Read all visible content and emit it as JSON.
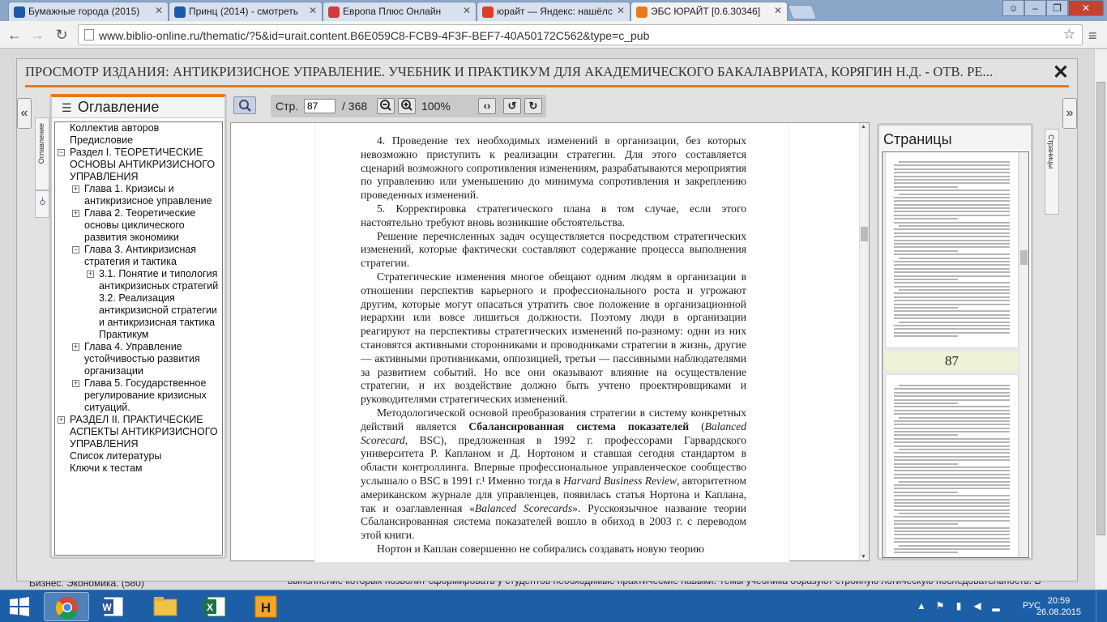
{
  "browser": {
    "tabs": [
      {
        "title": "Бумажные города (2015)",
        "favicon_color": "#1e5aa8"
      },
      {
        "title": "Принц (2014) - смотреть",
        "favicon_color": "#1e5aa8"
      },
      {
        "title": "Европа Плюс Онлайн",
        "favicon_color": "#d23c3c"
      },
      {
        "title": "юрайт — Яндекс: нашёлс",
        "favicon_color": "#e23b2a"
      },
      {
        "title": "ЭБС ЮРАЙТ [0.6.30346]",
        "favicon_color": "#e87b1c"
      }
    ],
    "url": "www.biblio-online.ru/thematic/?5&id=urait.content.B6E059C8-FCB9-4F3F-BEF7-40A50172C562&type=c_pub"
  },
  "background_page": {
    "left_text": "Бизнес. Экономика. (580)",
    "bottom_text": "выполнение которых позволит сформировать у студентов необходимые практические навыки. Темы учебника образуют стройную логическую последовательность. В"
  },
  "viewer": {
    "title": "ПРОСМОТР ИЗДАНИЯ: АНТИКРИЗИСНОЕ УПРАВЛЕНИЕ. УЧЕБНИК И ПРАКТИКУМ ДЛЯ АКАДЕМИЧЕСКОГО БАКАЛАВРИАТА, КОРЯГИН Н.Д. - ОТВ. РЕ...",
    "close_label": "✕",
    "accent_color": "#e87b1c",
    "left_tab_label": "Оглавление",
    "right_tab_label": "Страницы",
    "toolbar": {
      "page_label": "Стр.",
      "current_page": "87",
      "total_pages": "/ 368",
      "zoom": "100%"
    },
    "toc": {
      "title": "Оглавление",
      "items": [
        {
          "label": "Коллектив авторов",
          "level": 0,
          "toggle": ""
        },
        {
          "label": "Предисловие",
          "level": 0,
          "toggle": ""
        },
        {
          "label": "Раздел I. ТЕОРЕТИЧЕСКИЕ ОСНОВЫ АНТИКРИЗИСНОГО УПРАВЛЕНИЯ",
          "level": 0,
          "toggle": "−"
        },
        {
          "label": "Глава 1. Кризисы и антикризисное управление",
          "level": 1,
          "toggle": "+"
        },
        {
          "label": "Глава 2. Теоретические основы циклического развития экономики",
          "level": 1,
          "toggle": "+"
        },
        {
          "label": "Глава 3. Антикризисная стратегия и тактика",
          "level": 1,
          "toggle": "−"
        },
        {
          "label": "3.1. Понятие и типология антикризисных стратегий",
          "level": 2,
          "toggle": "+"
        },
        {
          "label": "3.2. Реализация антикризисной стратегии",
          "level": 2,
          "toggle": ""
        },
        {
          "label": "и антикризисная тактика",
          "level": 2,
          "toggle": ""
        },
        {
          "label": "Практикум",
          "level": 2,
          "toggle": ""
        },
        {
          "label": "Глава 4. Управление устойчивостью развития организации",
          "level": 1,
          "toggle": "+"
        },
        {
          "label": "Глава 5. Государственное регулирование кризисных ситуаций.",
          "level": 1,
          "toggle": "+"
        },
        {
          "label": "РАЗДЕЛ II. ПРАКТИЧЕСКИЕ АСПЕКТЫ АНТИКРИЗИСНОГО УПРАВЛЕНИЯ",
          "level": 0,
          "toggle": "+"
        },
        {
          "label": "Список литературы",
          "level": 0,
          "toggle": ""
        },
        {
          "label": "Ключи к тестам",
          "level": 0,
          "toggle": ""
        }
      ]
    },
    "document": {
      "paragraphs": [
        {
          "parts": [
            {
              "t": "4. Проведение тех необходимых изменений в организации, без которых невозможно приступить к реализации стратегии. Для этого составляется сценарий возможного сопротивления изменениям, разрабатываются мероприятия по управлению или уменьшению до минимума сопротивления и закреплению проведенных изменений.",
              "s": ""
            }
          ]
        },
        {
          "parts": [
            {
              "t": "5. Корректировка стратегического плана в том случае, если этого настоятельно требуют вновь возникшие обстоятельства.",
              "s": ""
            }
          ]
        },
        {
          "parts": [
            {
              "t": "Решение перечисленных задач осуществляется посредством стратегических изменений, которые фактически составляют содержание процесса выполнения стратегии.",
              "s": ""
            }
          ]
        },
        {
          "parts": [
            {
              "t": "Стратегические изменения многое обещают одним людям в организации в отношении перспектив карьерного и профессионального роста и угрожают другим, которые могут опасаться утратить свое положение в организационной иерархии или вовсе лишиться должности. Поэтому люди в организации реагируют на перспективы стратегических изменений по-разному: одни из них становятся активными сторонниками и проводниками стратегии в жизнь, другие — активными противниками, оппозицией, третьи — пассивными наблюдателями за развитием событий. Но все они оказывают влияние на осуществление стратегии, и их воздействие должно быть учтено проектировщиками и руководителями стратегических изменений.",
              "s": ""
            }
          ]
        },
        {
          "parts": [
            {
              "t": "Методологической основой преобразования стратегии в систему конкретных действий является ",
              "s": ""
            },
            {
              "t": "Сбалансированная система показателей",
              "s": "b"
            },
            {
              "t": " (",
              "s": ""
            },
            {
              "t": "Balanced Scorecard",
              "s": "i"
            },
            {
              "t": ", BSC), предложенная в 1992 г. профессорами Гарвардского университета Р. Капланом и Д. Нортоном и ставшая сегодня стандартом в области контроллинга. Впервые профессиональное управленческое сообщество услышало о BSC в 1991 г.¹ Именно тогда в ",
              "s": ""
            },
            {
              "t": "Harvard Business Review",
              "s": "i"
            },
            {
              "t": ", авторитетном американском журнале для управленцев, появилась статья Нортона и Каплана, так и озаглавленная «",
              "s": ""
            },
            {
              "t": "Balanced Scorecards",
              "s": "i"
            },
            {
              "t": "». Русскоязычное название теории Сбалансированная система показателей вошло в обиход в 2003 г. с переводом этой книги.",
              "s": ""
            }
          ]
        },
        {
          "parts": [
            {
              "t": "Нортон и Каплан совершенно не собирались создавать новую теорию",
              "s": ""
            }
          ]
        }
      ]
    },
    "pages_panel": {
      "title": "Страницы",
      "page_number": "87"
    }
  },
  "taskbar": {
    "language": "РУС",
    "time": "20:59",
    "date": "26.08.2015"
  }
}
